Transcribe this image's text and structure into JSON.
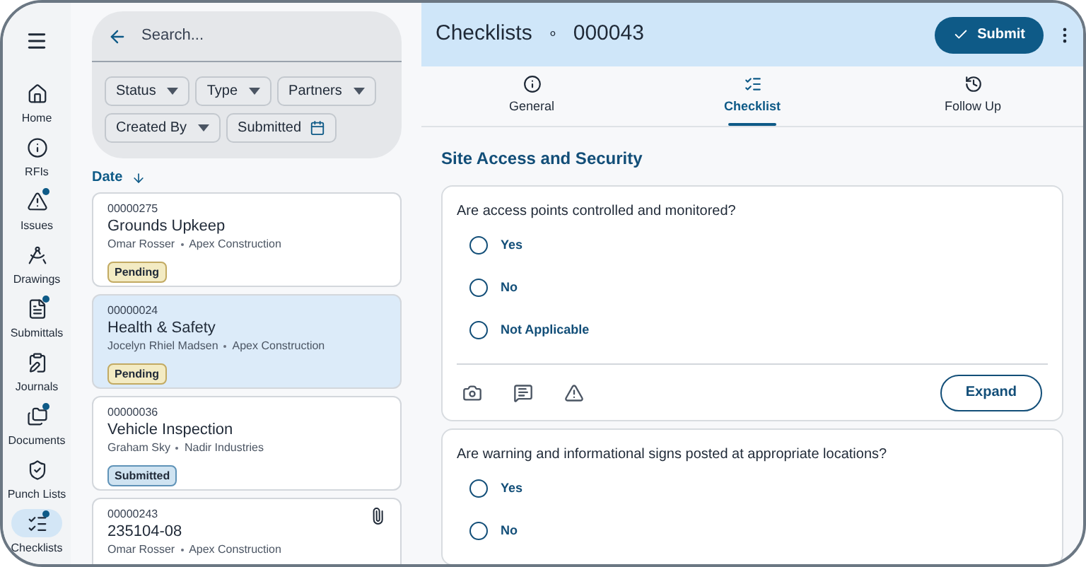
{
  "nav": {
    "items": [
      {
        "label": "Home",
        "selected": false,
        "dot": false
      },
      {
        "label": "RFIs",
        "selected": false,
        "dot": false
      },
      {
        "label": "Issues",
        "selected": false,
        "dot": true
      },
      {
        "label": "Drawings",
        "selected": false,
        "dot": false
      },
      {
        "label": "Submittals",
        "selected": false,
        "dot": true
      },
      {
        "label": "Journals",
        "selected": false,
        "dot": false
      },
      {
        "label": "Documents",
        "selected": false,
        "dot": true
      },
      {
        "label": "Punch Lists",
        "selected": false,
        "dot": false
      },
      {
        "label": "Checklists",
        "selected": true,
        "dot": true
      }
    ]
  },
  "search": {
    "placeholder": "Search..."
  },
  "filters": [
    {
      "label": "Status",
      "kind": "dropdown"
    },
    {
      "label": "Type",
      "kind": "dropdown"
    },
    {
      "label": "Partners",
      "kind": "dropdown"
    },
    {
      "label": "Created By",
      "kind": "dropdown"
    },
    {
      "label": "Submitted",
      "kind": "date"
    }
  ],
  "sort": {
    "label": "Date"
  },
  "list": [
    {
      "id": "00000275",
      "title": "Grounds Upkeep",
      "person": "Omar Rosser",
      "company": "Apex Construction",
      "status": {
        "label": "Pending",
        "kind": "pending"
      },
      "selected": false,
      "attachment": false
    },
    {
      "id": "00000024",
      "title": "Health & Safety",
      "person": "Jocelyn Rhiel Madsen",
      "company": "Apex Construction",
      "status": {
        "label": "Pending",
        "kind": "pending"
      },
      "selected": true,
      "attachment": false
    },
    {
      "id": "00000036",
      "title": "Vehicle Inspection",
      "person": "Graham Sky",
      "company": "Nadir Industries",
      "status": {
        "label": "Submitted",
        "kind": "submitted"
      },
      "selected": false,
      "attachment": false
    },
    {
      "id": "00000243",
      "title": "235104-08",
      "person": "Omar Rosser",
      "company": "Apex Construction",
      "selected": false,
      "attachment": true
    }
  ],
  "header": {
    "title": "Checklists",
    "separator": "∘",
    "number": "000043",
    "submit": "Submit"
  },
  "tabs": [
    {
      "label": "General",
      "selected": false
    },
    {
      "label": "Checklist",
      "selected": true
    },
    {
      "label": "Follow Up",
      "selected": false
    }
  ],
  "section_title": "Site Access and Security",
  "questions": [
    {
      "text": "Are access points controlled and monitored?",
      "options": [
        {
          "label": "Yes",
          "selected": false
        },
        {
          "label": "No",
          "selected": false
        },
        {
          "label": "Not Applicable",
          "selected": false
        }
      ],
      "expand": "Expand"
    },
    {
      "text": "Are warning and informational signs posted at appropriate locations?",
      "options": [
        {
          "label": "Yes",
          "selected": false
        },
        {
          "label": "No",
          "selected": false
        }
      ]
    }
  ]
}
